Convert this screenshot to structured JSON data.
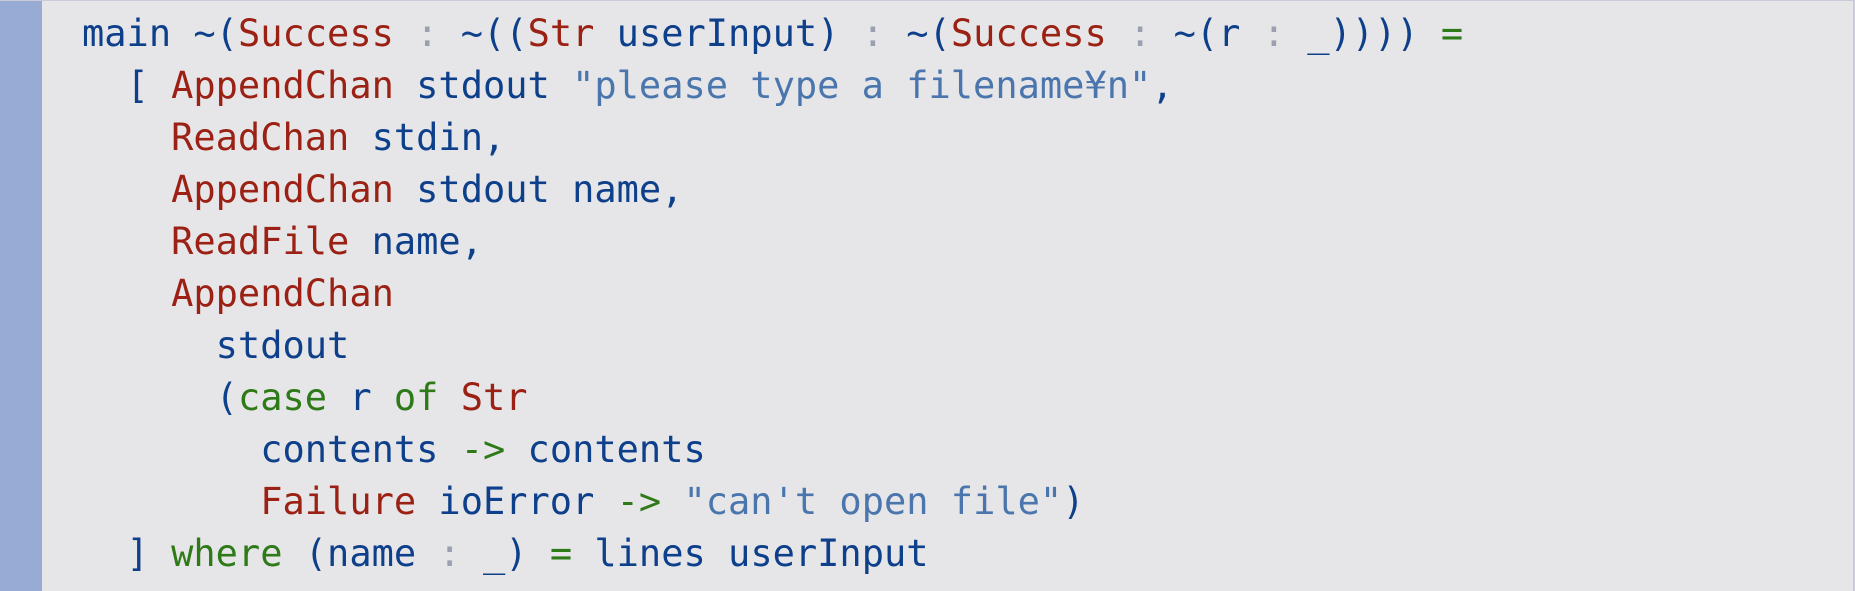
{
  "colors": {
    "background": "#e6e6e8",
    "gutter": "#97abd4",
    "identifier": "#0d3f8a",
    "constructor": "#9a2113",
    "keyword": "#2e7a18",
    "string": "#4a76ad",
    "colon": "#9aa0b0"
  },
  "code": {
    "lines": [
      [
        {
          "t": "main ",
          "k": "id"
        },
        {
          "t": "~",
          "k": "id"
        },
        {
          "t": "(",
          "k": "id"
        },
        {
          "t": "Success",
          "k": "con"
        },
        {
          "t": " : ",
          "k": "dim"
        },
        {
          "t": "~",
          "k": "id"
        },
        {
          "t": "((",
          "k": "id"
        },
        {
          "t": "Str",
          "k": "con"
        },
        {
          "t": " userInput) ",
          "k": "id"
        },
        {
          "t": ": ",
          "k": "dim"
        },
        {
          "t": "~",
          "k": "id"
        },
        {
          "t": "(",
          "k": "id"
        },
        {
          "t": "Success",
          "k": "con"
        },
        {
          "t": " : ",
          "k": "dim"
        },
        {
          "t": "~",
          "k": "id"
        },
        {
          "t": "(r ",
          "k": "id"
        },
        {
          "t": ":",
          "k": "dim"
        },
        {
          "t": " _)))) ",
          "k": "id"
        },
        {
          "t": "=",
          "k": "op"
        }
      ],
      [
        {
          "t": "  [ ",
          "k": "id"
        },
        {
          "t": "AppendChan",
          "k": "con"
        },
        {
          "t": " stdout ",
          "k": "id"
        },
        {
          "t": "\"please type a filename¥n\"",
          "k": "str"
        },
        {
          "t": ",",
          "k": "id"
        }
      ],
      [
        {
          "t": "    ",
          "k": "id"
        },
        {
          "t": "ReadChan",
          "k": "con"
        },
        {
          "t": " stdin,",
          "k": "id"
        }
      ],
      [
        {
          "t": "    ",
          "k": "id"
        },
        {
          "t": "AppendChan",
          "k": "con"
        },
        {
          "t": " stdout name,",
          "k": "id"
        }
      ],
      [
        {
          "t": "    ",
          "k": "id"
        },
        {
          "t": "ReadFile",
          "k": "con"
        },
        {
          "t": " name,",
          "k": "id"
        }
      ],
      [
        {
          "t": "    ",
          "k": "id"
        },
        {
          "t": "AppendChan",
          "k": "con"
        }
      ],
      [
        {
          "t": "      stdout",
          "k": "id"
        }
      ],
      [
        {
          "t": "      (",
          "k": "id"
        },
        {
          "t": "case",
          "k": "kw"
        },
        {
          "t": " r ",
          "k": "id"
        },
        {
          "t": "of",
          "k": "kw"
        },
        {
          "t": " ",
          "k": "id"
        },
        {
          "t": "Str",
          "k": "con"
        }
      ],
      [
        {
          "t": "        contents ",
          "k": "id"
        },
        {
          "t": "->",
          "k": "op"
        },
        {
          "t": " contents",
          "k": "id"
        }
      ],
      [
        {
          "t": "        ",
          "k": "id"
        },
        {
          "t": "Failure",
          "k": "con"
        },
        {
          "t": " ioError ",
          "k": "id"
        },
        {
          "t": "->",
          "k": "op"
        },
        {
          "t": " ",
          "k": "id"
        },
        {
          "t": "\"can't open file\"",
          "k": "str"
        },
        {
          "t": ")",
          "k": "id"
        }
      ],
      [
        {
          "t": "  ] ",
          "k": "id"
        },
        {
          "t": "where",
          "k": "kw"
        },
        {
          "t": " (name ",
          "k": "id"
        },
        {
          "t": ":",
          "k": "dim"
        },
        {
          "t": " _) ",
          "k": "id"
        },
        {
          "t": "=",
          "k": "op"
        },
        {
          "t": " lines userInput",
          "k": "id"
        }
      ]
    ]
  }
}
